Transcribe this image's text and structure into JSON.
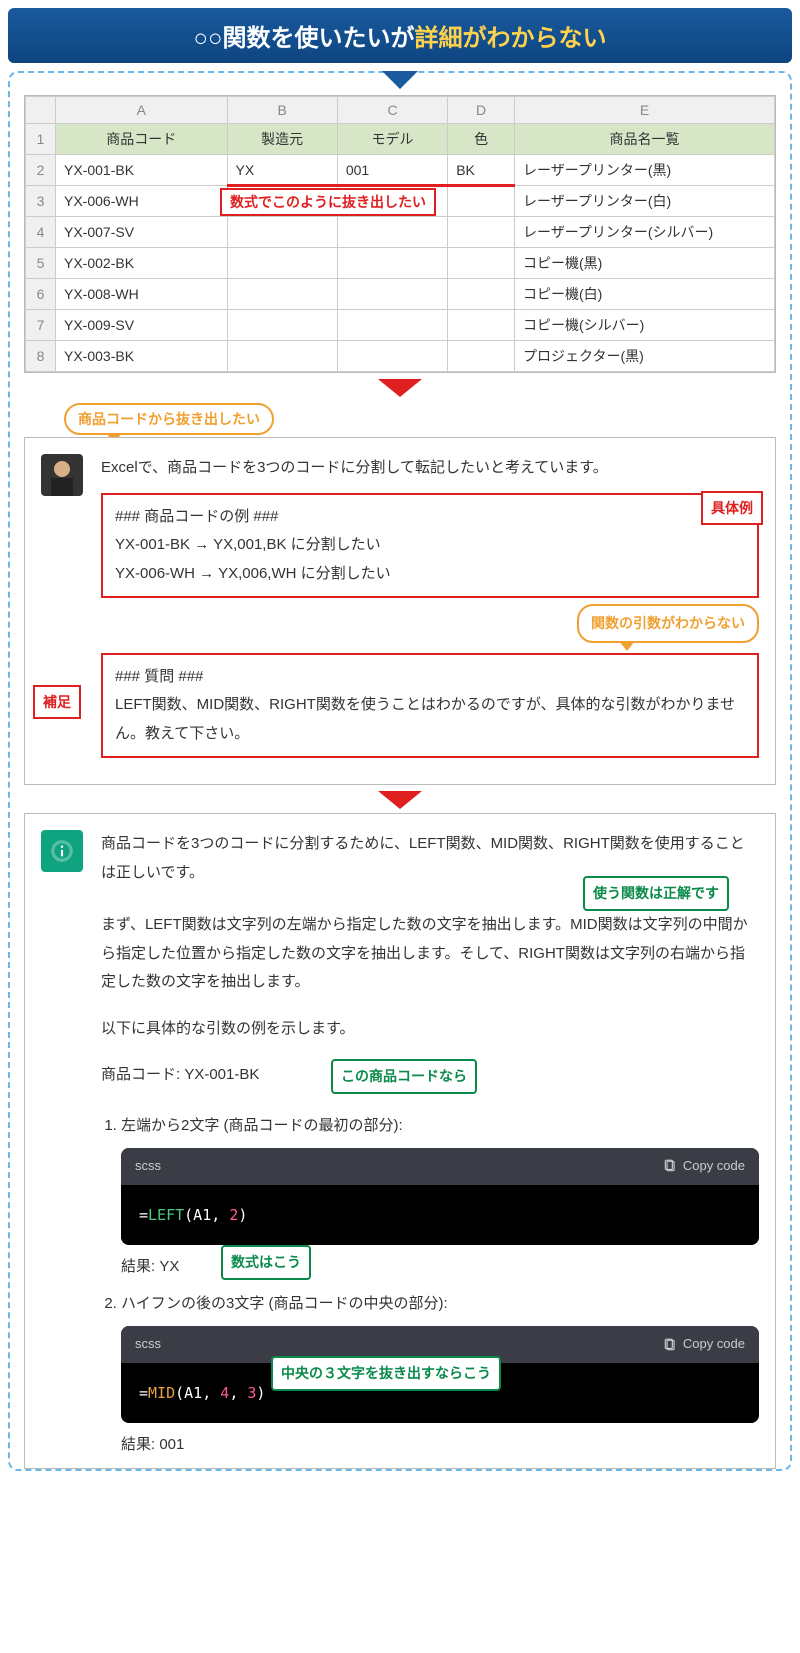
{
  "title": {
    "pre": "○○関数を使いたいが",
    "hl": "詳細がわからない"
  },
  "excel": {
    "cols": [
      "",
      "A",
      "B",
      "C",
      "D",
      "E"
    ],
    "headers": [
      "1",
      "商品コード",
      "製造元",
      "モデル",
      "色",
      "商品名一覧"
    ],
    "rows": [
      [
        "2",
        "YX-001-BK",
        "YX",
        "001",
        "BK",
        "レーザープリンター(黒)"
      ],
      [
        "3",
        "YX-006-WH",
        "",
        "",
        "",
        "レーザープリンター(白)"
      ],
      [
        "4",
        "YX-007-SV",
        "",
        "",
        "",
        "レーザープリンター(シルバー)"
      ],
      [
        "5",
        "YX-002-BK",
        "",
        "",
        "",
        "コピー機(黒)"
      ],
      [
        "6",
        "YX-008-WH",
        "",
        "",
        "",
        "コピー機(白)"
      ],
      [
        "7",
        "YX-009-SV",
        "",
        "",
        "",
        "コピー機(シルバー)"
      ],
      [
        "8",
        "YX-003-BK",
        "",
        "",
        "",
        "プロジェクター(黒)"
      ]
    ],
    "annot": "数式でこのように抜き出したい"
  },
  "user": {
    "bubble": "商品コードから抜き出したい",
    "intro": "Excelで、商品コードを3つのコードに分割して転記したいと考えています。",
    "ex_title": "### 商品コードの例 ###",
    "ex_l1": "YX-001-BK → YX,001,BK に分割したい",
    "ex_l2": "YX-006-WH → YX,006,WH に分割したい",
    "ex_tag": "具体例",
    "q_title": "### 質問 ###",
    "q_body": "LEFT関数、MID関数、RIGHT関数を使うことはわかるのですが、具体的な引数がわかりません。教えて下さい。",
    "left_tag": "補足",
    "right_bubble": "関数の引数がわからない"
  },
  "gpt": {
    "p1": "商品コードを3つのコードに分割するために、LEFT関数、MID関数、RIGHT関数を使用することは正しいです。",
    "tag1": "使う関数は正解です",
    "p2": "まず、LEFT関数は文字列の左端から指定した数の文字を抽出します。MID関数は文字列の中間から指定した位置から指定した数の文字を抽出します。そして、RIGHT関数は文字列の右端から指定した数の文字を抽出します。",
    "p3": "以下に具体的な引数の例を示します。",
    "p4": "商品コード: YX-001-BK",
    "tag2": "この商品コードなら",
    "li1": "左端から2文字 (商品コードの最初の部分):",
    "code_lang": "scss",
    "copy": "Copy code",
    "code1": {
      "pre": "=",
      "fn": "LEFT",
      "args": "(A1, ",
      "n": "2",
      "end": ")"
    },
    "res1": "結果: YX",
    "tag3": "数式はこう",
    "li2": "ハイフンの後の3文字 (商品コードの中央の部分):",
    "code2": {
      "pre": "=",
      "fn": "MID",
      "args": "(A1, ",
      "n1": "4",
      "sep": ", ",
      "n2": "3",
      "end": ")"
    },
    "tag4": "中央の３文字を抜き出すならこう",
    "res2": "結果: 001"
  }
}
